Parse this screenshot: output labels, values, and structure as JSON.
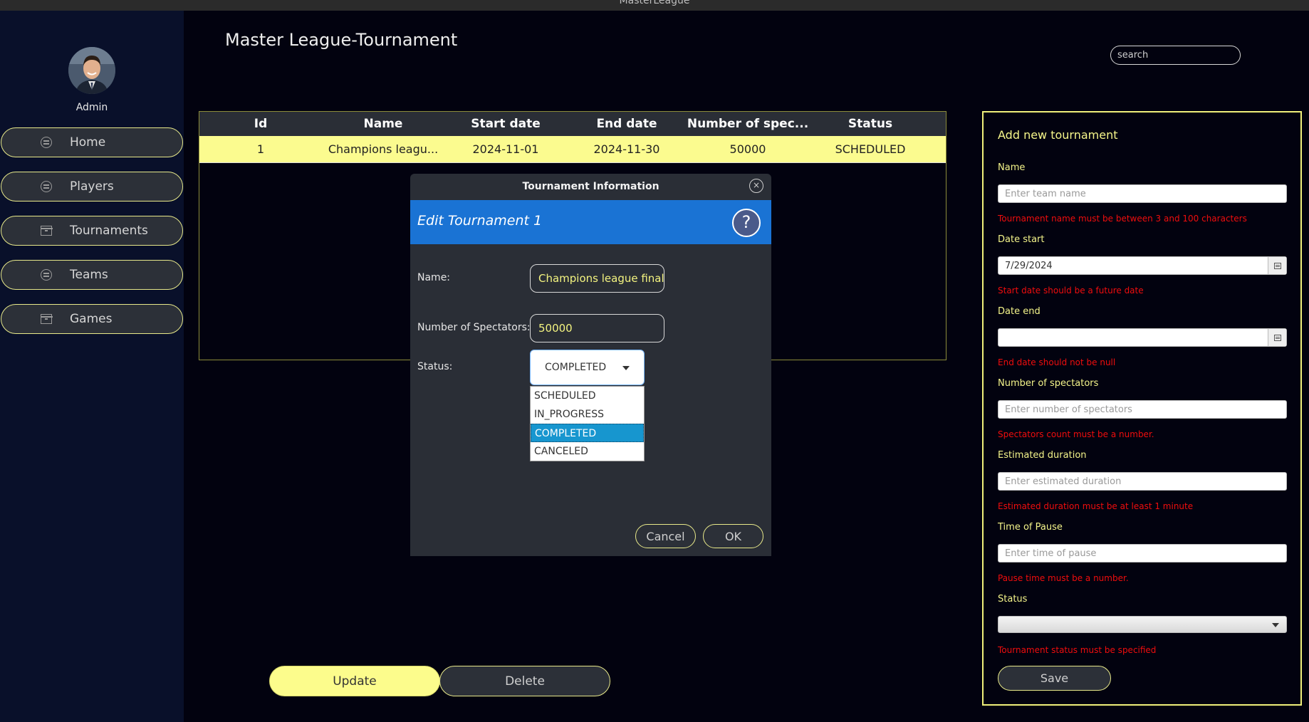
{
  "window": {
    "title": "MasterLeague"
  },
  "sidebar": {
    "user_label": "Admin",
    "items": [
      {
        "label": "Home",
        "icon": "list-circle-icon"
      },
      {
        "label": "Players",
        "icon": "list-circle-icon"
      },
      {
        "label": "Tournaments",
        "icon": "archive-box-icon"
      },
      {
        "label": "Teams",
        "icon": "list-circle-icon"
      },
      {
        "label": "Games",
        "icon": "archive-box-icon"
      }
    ]
  },
  "header": {
    "title": "Master League-Tournament",
    "search_placeholder": "search"
  },
  "table": {
    "columns": [
      "Id",
      "Name",
      "Start date",
      "End date",
      "Number of spec...",
      "Status"
    ],
    "rows": [
      {
        "id": "1",
        "name": "Champions leagu...",
        "start_date": "2024-11-01",
        "end_date": "2024-11-30",
        "spectators": "50000",
        "status": "SCHEDULED"
      }
    ]
  },
  "actions": {
    "update_label": "Update",
    "delete_label": "Delete"
  },
  "dialog": {
    "title": "Tournament Information",
    "close_glyph": "×",
    "header": "Edit Tournament 1",
    "help_glyph": "?",
    "name_label": "Name:",
    "name_value": "Champions league final",
    "spectators_label": "Number of Spectators:",
    "spectators_value": "50000",
    "status_label": "Status:",
    "status_selected": "COMPLETED",
    "status_options": [
      "SCHEDULED",
      "IN_PROGRESS",
      "COMPLETED",
      "CANCELED"
    ],
    "cancel_label": "Cancel",
    "ok_label": "OK"
  },
  "panel": {
    "title": "Add new tournament",
    "name_label": "Name",
    "name_placeholder": "Enter team name",
    "name_error": "Tournament name must be between 3 and 100 characters",
    "date_start_label": "Date start",
    "date_start_value": "7/29/2024",
    "date_start_error": "Start date should be a future date",
    "date_end_label": "Date end",
    "date_end_value": "",
    "date_end_error": "End date should not be null",
    "spectators_label": "Number of spectators",
    "spectators_placeholder": "Enter number of spectators",
    "spectators_error": "Spectators count must be a number.",
    "duration_label": "Estimated duration",
    "duration_placeholder": "Enter estimated duration",
    "duration_error": "Estimated duration must be at least 1 minute",
    "pause_label": "Time of Pause",
    "pause_placeholder": "Enter time of pause",
    "pause_error": "Pause time must be a number.",
    "status_label": "Status",
    "status_value": "",
    "status_error": "Tournament status must be specified",
    "save_label": "Save"
  },
  "colors": {
    "accent_yellow": "#fcfc8c",
    "dialog_header_blue": "#1a73d4",
    "error_red": "#f00d0d",
    "selected_option": "#1796cf"
  }
}
